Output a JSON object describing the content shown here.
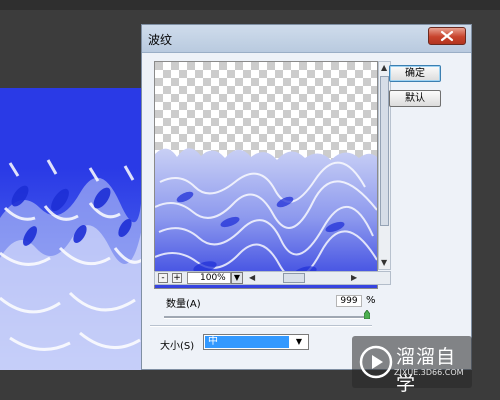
{
  "dialog": {
    "title": "波纹",
    "ok_label": "确定",
    "default_label": "默认",
    "zoom": {
      "minus": "-",
      "plus": "+",
      "value": "100%"
    },
    "amount": {
      "label": "数量(A)",
      "value": "999",
      "unit": "%",
      "fraction": 1.0
    },
    "size": {
      "label": "大小(S)",
      "selected": "中"
    }
  },
  "watermark": {
    "title": "溜溜自学",
    "subtitle": "ZIXUE.3D66.COM"
  },
  "colors": {
    "accent": "#3399ff",
    "canvas_blue": "#2a3ae6"
  }
}
